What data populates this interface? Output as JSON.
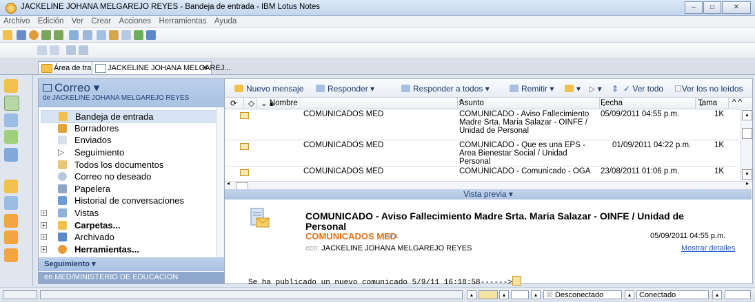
{
  "window": {
    "title": "JACKELINE JOHANA MELGAREJO REYES - Bandeja de entrada - IBM Lotus Notes"
  },
  "menu": [
    "Archivo",
    "Edición",
    "Ver",
    "Crear",
    "Acciones",
    "Herramientas",
    "Ayuda"
  ],
  "tabs": [
    {
      "label": "Área de trabajo"
    },
    {
      "label": "JACKELINE JOHANA MELGAREJ..."
    }
  ],
  "nav": {
    "title": "Correo",
    "subtitle": "de JACKELINE JOHANA MELGAREJO REYES",
    "items": [
      {
        "label": "Bandeja de entrada"
      },
      {
        "label": "Borradores"
      },
      {
        "label": "Enviados"
      },
      {
        "label": "Seguimiento"
      },
      {
        "label": "Todos los documentos"
      },
      {
        "label": "Correo no deseado"
      },
      {
        "label": "Papelera"
      },
      {
        "label": "Historial de conversaciones"
      },
      {
        "label": "Vistas"
      },
      {
        "label": "Carpetas..."
      },
      {
        "label": "Archivado"
      },
      {
        "label": "Herramientas..."
      }
    ],
    "section": "Seguimiento",
    "footer": "en MED/MINISTERIO DE EDUCACION"
  },
  "actions": {
    "new": "Nuevo mensaje",
    "reply": "Responder",
    "reply_all": "Responder a todos",
    "forward": "Remitir",
    "view_all": "Ver todo",
    "view_unread": "Ver los no leídos"
  },
  "columns": {
    "name": "Nombre",
    "subject": "Asunto",
    "date": "Fecha",
    "size": "Tama"
  },
  "messages": [
    {
      "from": "COMUNICADOS MED",
      "subject": "COMUNICADO - Aviso Fallecimiento Madre Srta. Maria Salazar - OINFE / Unidad de Personal",
      "date": "05/09/2011 04:55 p.m.",
      "size": "1K"
    },
    {
      "from": "COMUNICADOS MED",
      "subject": "COMUNICADO - Que es una EPS - Area Bienestar Social / Unidad Personal",
      "date": "01/09/2011 04:22 p.m.",
      "size": "1K"
    },
    {
      "from": "COMUNICADOS MED",
      "subject": "COMUNICADO - Comunicado - OGA",
      "date": "23/08/2011 01:06 p.m.",
      "size": "1K"
    }
  ],
  "preview": {
    "toggle": "Vista previa",
    "subject": "COMUNICADO - Aviso Fallecimiento Madre Srta. Maria Salazar - OINFE / Unidad de Personal",
    "sender": "COMUNICADOS MED",
    "to_label": "para:",
    "date": "05/09/2011 04:55 p.m.",
    "cco_label": "cco:",
    "cco": "JACKELINE JOHANA MELGAREJO REYES",
    "details": "Mostrar detalles",
    "body": "Se ha publicado un nuevo comunicado 5/9/11 16:18:58------>"
  },
  "status": {
    "offline": "Desconectado",
    "online": "Conectado"
  },
  "colors": {
    "accent": "#e0731c",
    "link": "#1a55c8",
    "nav_header": "#bcd0ea"
  }
}
